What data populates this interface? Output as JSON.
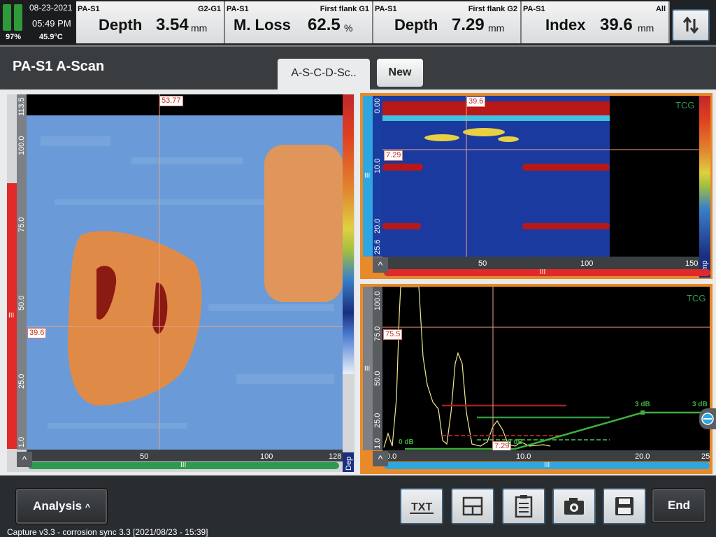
{
  "status": {
    "date": "08-23-2021",
    "time": "05:49 PM",
    "battery": "97%",
    "temp": "45.9°C"
  },
  "readings": [
    {
      "source": "PA-S1",
      "gate": "G2-G1",
      "name": "Depth",
      "value": "3.54",
      "unit": "mm"
    },
    {
      "source": "PA-S1",
      "gate": "First flank G1",
      "name": "M. Loss",
      "value": "62.5",
      "unit": "%"
    },
    {
      "source": "PA-S1",
      "gate": "First flank G2",
      "name": "Depth",
      "value": "7.29",
      "unit": "mm"
    },
    {
      "source": "PA-S1",
      "gate": "All",
      "name": "Index",
      "value": "39.6",
      "unit": "mm"
    }
  ],
  "swap_icon": "swap-arrows-icon",
  "page_title": "PA-S1 A-Scan",
  "tabs": [
    {
      "label": "A-S-C-D-Sc.."
    },
    {
      "label": "New"
    }
  ],
  "cscan": {
    "yticks": [
      "113.5",
      "100.0",
      "75.0",
      "50.0",
      "25.0",
      "1.0"
    ],
    "xticks": [
      "50",
      "100",
      "128"
    ],
    "cursor_x": "53.77",
    "cursor_y": "39.6",
    "palette_label": "Dep",
    "grip": "III"
  },
  "bscan": {
    "yticks": [
      "0.00",
      "10.0",
      "20.0",
      "25.6"
    ],
    "xticks": [
      "50",
      "100",
      "150"
    ],
    "cursor_x": "39.6",
    "cursor_y": "7.29",
    "tcg": "TCG",
    "palette_label": "Amp",
    "grip": "III"
  },
  "ascan": {
    "yticks": [
      "100.0",
      "75.0",
      "50.0",
      "25.0",
      "1.0"
    ],
    "xticks": [
      "0.0",
      "10.0",
      "20.0",
      "25"
    ],
    "cursor_y": "75.5",
    "cursor_x": "7.29",
    "tcg": "TCG",
    "db_labels": [
      "0 dB",
      "0 dB",
      "3 dB",
      "3 dB"
    ],
    "grip": "III",
    "colors": {
      "signal": "#f0e890",
      "gate1": "#a02020",
      "gate2": "#2e9a40",
      "tcg_curve": "#3fae3f"
    }
  },
  "bottom": {
    "analysis_label": "Analysis",
    "end_label": "End",
    "tools": [
      {
        "name": "txt-report-icon"
      },
      {
        "name": "layout-icon"
      },
      {
        "name": "clipboard-icon"
      },
      {
        "name": "camera-icon"
      },
      {
        "name": "save-icon"
      }
    ]
  },
  "footer": "Capture v3.3 - corrosion sync 3.3 [2021/08/23 - 15:39]"
}
